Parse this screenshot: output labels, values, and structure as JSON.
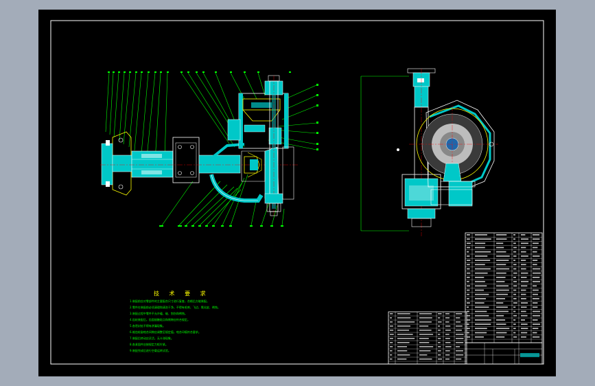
{
  "drawing": {
    "technical_requirements_title": "技 术 要 求",
    "technical_requirements": [
      "1.装配前应对零部件的主要配合尺寸进行复查，合格后方能装配。",
      "2.零件在装配前必须清理和清洗干净，不得有毛刺、飞边、氧化皮、锈蚀。",
      "3.装配过程中零件不允许磕、碰、划伤和锈蚀。",
      "4.齿轮装配后，齿面接触斑点和侧隙应符合规定。",
      "5.各密封处不得有渗漏现象。",
      "6.锥齿轮副啮合间隙应调整至规定值，啮合印痕符合要求。",
      "7.装配后转动应灵活，无卡滞现象。",
      "8.各紧固件应按规定力矩拧紧。",
      "9.装配完成后进行空载运转试验。"
    ]
  },
  "colors": {
    "outer_bg": "#a3acb9",
    "sheet_bg": "#000000",
    "border": "#ffffff",
    "section_fill": "#00c8c8",
    "leader_lines": "#00ff00",
    "outline": "#ffffff",
    "gear": "#ffff00",
    "centerline": "#ff0000",
    "text_title": "#ffff00",
    "text_body": "#00ff00"
  }
}
